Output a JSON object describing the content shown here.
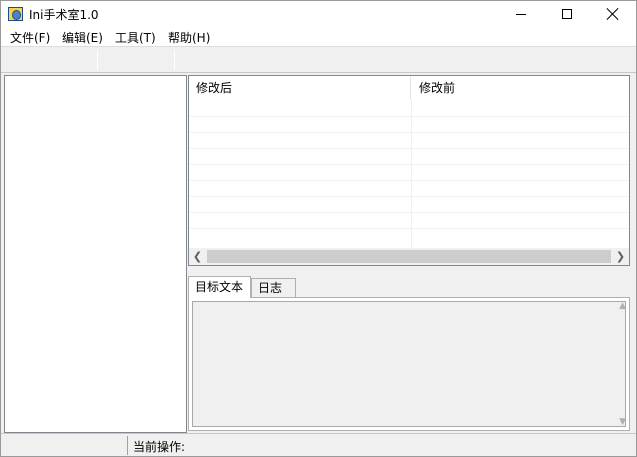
{
  "window": {
    "title": "Ini手术室1.0",
    "icon": "app-icon"
  },
  "menu": {
    "items": [
      {
        "label": "文件(F)"
      },
      {
        "label": "编辑(E)"
      },
      {
        "label": "工具(T)"
      },
      {
        "label": "帮助(H)"
      }
    ]
  },
  "listview": {
    "columns": [
      {
        "label": "修改后"
      },
      {
        "label": "修改前"
      }
    ],
    "rows": []
  },
  "tabs": [
    {
      "label": "目标文本",
      "active": true
    },
    {
      "label": "日志",
      "active": false
    }
  ],
  "textarea": {
    "value": ""
  },
  "statusbar": {
    "current_operation_label": "当前操作:"
  }
}
